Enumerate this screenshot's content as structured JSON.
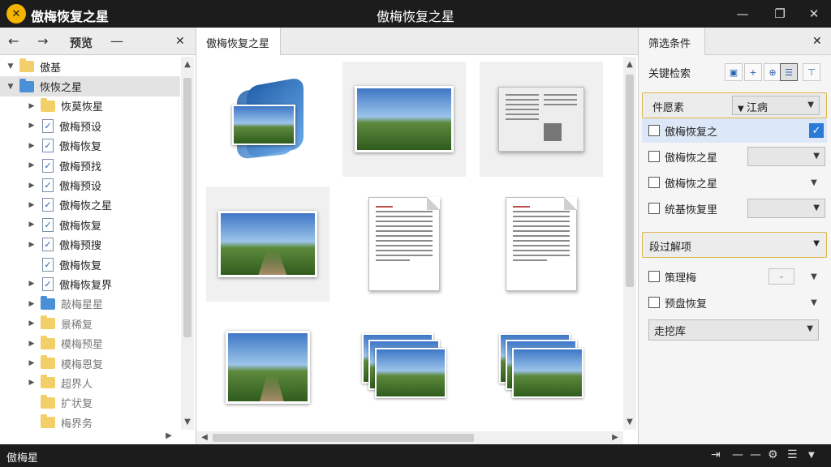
{
  "app": {
    "title_left": "傲梅恢复之星",
    "title_center": "傲梅恢复之星",
    "logo_glyph": "✕"
  },
  "window_controls": {
    "minimize": "—",
    "restore": "❐",
    "close": "✕"
  },
  "left_panel": {
    "back": "←",
    "forward": "→",
    "label": "预览",
    "dash": "—",
    "close": "✕",
    "tree": [
      {
        "label": "傲基",
        "level": 0,
        "arrow": "▼",
        "icon": "folder",
        "faded": false
      },
      {
        "label": "恢恢之星",
        "level": 0,
        "arrow": "▼",
        "icon": "folder-blue",
        "selected": true
      },
      {
        "label": "恢莫恢星",
        "level": 1,
        "arrow": "▶",
        "icon": "folder"
      },
      {
        "label": "傲梅预设",
        "level": 1,
        "arrow": "▶",
        "icon": "doc"
      },
      {
        "label": "傲梅恢复",
        "level": 1,
        "arrow": "▶",
        "icon": "doc"
      },
      {
        "label": "傲梅预找",
        "level": 1,
        "arrow": "▶",
        "icon": "doc"
      },
      {
        "label": "傲梅预设",
        "level": 1,
        "arrow": "▶",
        "icon": "doc"
      },
      {
        "label": "傲梅恢之星",
        "level": 1,
        "arrow": "▶",
        "icon": "doc"
      },
      {
        "label": "傲梅恢复",
        "level": 1,
        "arrow": "▶",
        "icon": "doc"
      },
      {
        "label": "傲梅预搜",
        "level": 1,
        "arrow": "▶",
        "icon": "doc"
      },
      {
        "label": "傲梅恢复",
        "level": 1,
        "arrow": "",
        "icon": "doc"
      },
      {
        "label": "傲梅恢复界",
        "level": 1,
        "arrow": "▶",
        "icon": "doc"
      },
      {
        "label": "敲梅星星",
        "level": 1,
        "arrow": "▶",
        "icon": "folder-blue",
        "faded": true
      },
      {
        "label": "景稀复",
        "level": 1,
        "arrow": "▶",
        "icon": "folder",
        "faded": true
      },
      {
        "label": "模梅预星",
        "level": 1,
        "arrow": "▶",
        "icon": "folder",
        "faded": true
      },
      {
        "label": "模梅恩复",
        "level": 1,
        "arrow": "▶",
        "icon": "folder",
        "faded": true
      },
      {
        "label": "超界人",
        "level": 1,
        "arrow": "▶",
        "icon": "folder",
        "faded": true
      },
      {
        "label": "扩状复",
        "level": 1,
        "arrow": "",
        "icon": "folder",
        "faded": true
      },
      {
        "label": "梅界务",
        "level": 1,
        "arrow": "",
        "icon": "folder",
        "faded": true
      }
    ]
  },
  "center_panel": {
    "tab_label": "傲梅恢复之星"
  },
  "right_panel": {
    "tab_label": "筛选条件",
    "close": "✕",
    "filter_label": "关键检索",
    "section1": {
      "label": "件愿素",
      "dropdown": "江病"
    },
    "rows": [
      {
        "label": "傲梅恢复之",
        "control": "checked",
        "highlight": true
      },
      {
        "label": "傲梅恢之星",
        "control": "dropdown"
      },
      {
        "label": "傲梅恢之星",
        "control": "caret"
      },
      {
        "label": "统基恢复里",
        "control": "dropdown"
      }
    ],
    "section2": {
      "label": "段过解项"
    },
    "rows2": [
      {
        "label": "策理梅",
        "control": "folder-caret"
      },
      {
        "label": "预盘恢复",
        "control": "caret"
      }
    ],
    "section3": {
      "label": "走挖库"
    }
  },
  "statusbar": {
    "text": "傲梅星",
    "icons": [
      "⇥",
      "—",
      "—",
      "⚙",
      "☰"
    ]
  }
}
